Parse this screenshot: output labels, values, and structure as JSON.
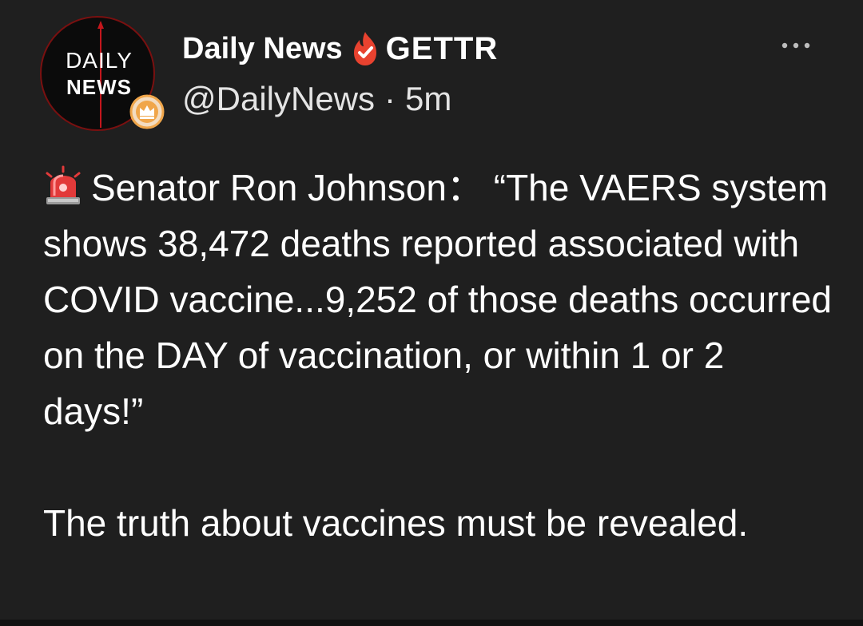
{
  "post": {
    "avatar": {
      "line1": "DAILY",
      "line2": "NEWS",
      "icon": "crown-badge-icon"
    },
    "author": {
      "display_name": "Daily News",
      "badge_icon": "gettr-verified-flame-icon",
      "platform": "GETTR",
      "handle": "@DailyNews",
      "separator": "·",
      "time": "5m"
    },
    "more_icon": "more-dots-icon",
    "body": {
      "emoji_icon": "siren-icon",
      "paragraph1": "Senator Ron Johnson：  “The VAERS system shows 38,472 deaths reported associated with COVID vaccine...9,252 of those deaths occurred on the DAY of vaccination, or within 1 or 2 days!”",
      "paragraph2": "The truth about vaccines must be revealed."
    }
  },
  "colors": {
    "background": "#1f1f1f",
    "text": "#ffffff",
    "secondary_text": "#e4e4e4",
    "gettr_red": "#e8422f",
    "avatar_ring": "#7a1010",
    "badge_gold": "#f0a64a"
  }
}
